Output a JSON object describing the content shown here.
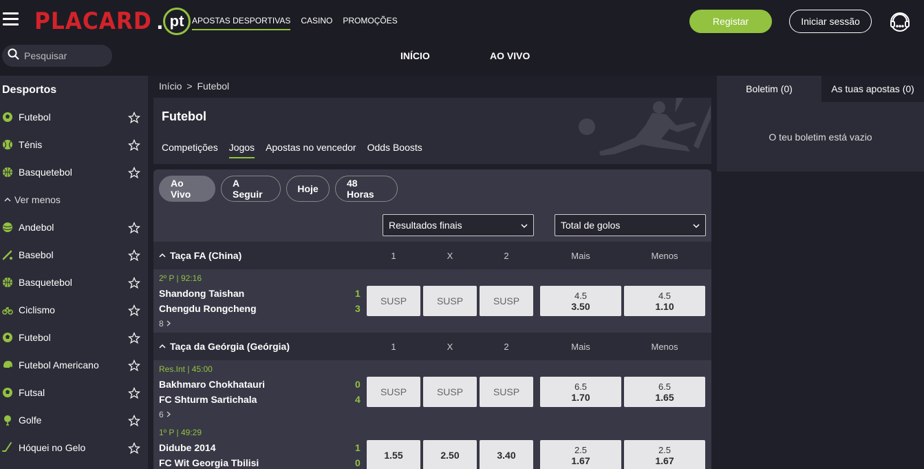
{
  "header": {
    "logo_text": "PLACARD",
    "logo_suffix": "pt",
    "nav": [
      {
        "label": "APOSTAS DESPORTIVAS",
        "active": true
      },
      {
        "label": "CASINO",
        "active": false
      },
      {
        "label": "PROMOÇÕES",
        "active": false
      }
    ],
    "register_label": "Registar",
    "login_label": "Iniciar sessão",
    "accent_color": "#93c240",
    "brand_color": "#d2232a"
  },
  "search": {
    "placeholder": "Pesquisar"
  },
  "subnav": {
    "home": "INÍCIO",
    "live": "AO VIVO"
  },
  "sidebar": {
    "title": "Desportos",
    "top_items": [
      {
        "label": "Futebol",
        "icon": "soccer-ball-icon"
      },
      {
        "label": "Ténis",
        "icon": "tennis-ball-icon"
      },
      {
        "label": "Basquetebol",
        "icon": "basketball-icon"
      }
    ],
    "toggle_label": "Ver menos",
    "items": [
      {
        "label": "Andebol",
        "icon": "handball-icon"
      },
      {
        "label": "Basebol",
        "icon": "baseball-bat-icon"
      },
      {
        "label": "Basquetebol",
        "icon": "basketball-icon"
      },
      {
        "label": "Ciclismo",
        "icon": "bicycle-icon"
      },
      {
        "label": "Futebol",
        "icon": "soccer-ball-icon"
      },
      {
        "label": "Futebol Americano",
        "icon": "football-helmet-icon"
      },
      {
        "label": "Futsal",
        "icon": "soccer-ball-icon"
      },
      {
        "label": "Golfe",
        "icon": "golf-ball-icon"
      },
      {
        "label": "Hóquei no Gelo",
        "icon": "hockey-stick-icon"
      }
    ]
  },
  "breadcrumb": {
    "home": "Início",
    "separator": ">",
    "current": "Futebol"
  },
  "page": {
    "title": "Futebol",
    "tabs": [
      {
        "label": "Competições",
        "active": false
      },
      {
        "label": "Jogos",
        "active": true
      },
      {
        "label": "Apostas no vencedor",
        "active": false
      },
      {
        "label": "Odds Boosts",
        "active": false
      }
    ]
  },
  "filters": [
    {
      "label": "Ao Vivo",
      "active": true
    },
    {
      "label": "A Seguir",
      "active": false
    },
    {
      "label": "Hoje",
      "active": false
    },
    {
      "label": "48 Horas",
      "active": false
    }
  ],
  "markets": {
    "left": "Resultados finais",
    "right": "Total de golos"
  },
  "columns": {
    "home": "1",
    "draw": "X",
    "away": "2",
    "over": "Mais",
    "under": "Menos"
  },
  "leagues": [
    {
      "name": "Taça FA (China)",
      "matches": [
        {
          "status": "2º P | 92:16",
          "home": "Shandong Taishan",
          "away": "Chengdu Rongcheng",
          "home_score": "1",
          "away_score": "3",
          "more": "8",
          "odds": [
            "SUSP",
            "SUSP",
            "SUSP"
          ],
          "over": {
            "line": "4.5",
            "odd": "3.50"
          },
          "under": {
            "line": "4.5",
            "odd": "1.10"
          }
        }
      ]
    },
    {
      "name": "Taça da Geórgia (Geórgia)",
      "matches": [
        {
          "status": "Res.Int | 45:00",
          "home": "Bakhmaro Chokhatauri",
          "away": "FC Shturm Sartichala",
          "home_score": "0",
          "away_score": "4",
          "more": "6",
          "odds": [
            "SUSP",
            "SUSP",
            "SUSP"
          ],
          "over": {
            "line": "6.5",
            "odd": "1.70"
          },
          "under": {
            "line": "6.5",
            "odd": "1.65"
          }
        },
        {
          "status": "1º P | 49:29",
          "home": "Didube 2014",
          "away": "FC Wit Georgia Tbilisi",
          "home_score": "1",
          "away_score": "0",
          "more": "",
          "odds": [
            "1.55",
            "2.50",
            "3.40"
          ],
          "over": {
            "line": "2.5",
            "odd": "1.67"
          },
          "under": {
            "line": "2.5",
            "odd": "1.67"
          }
        }
      ]
    }
  ],
  "betslip": {
    "tab_slip": "Boletim (0)",
    "tab_bets": "As tuas apostas (0)",
    "empty": "O teu boletim está vazio"
  }
}
